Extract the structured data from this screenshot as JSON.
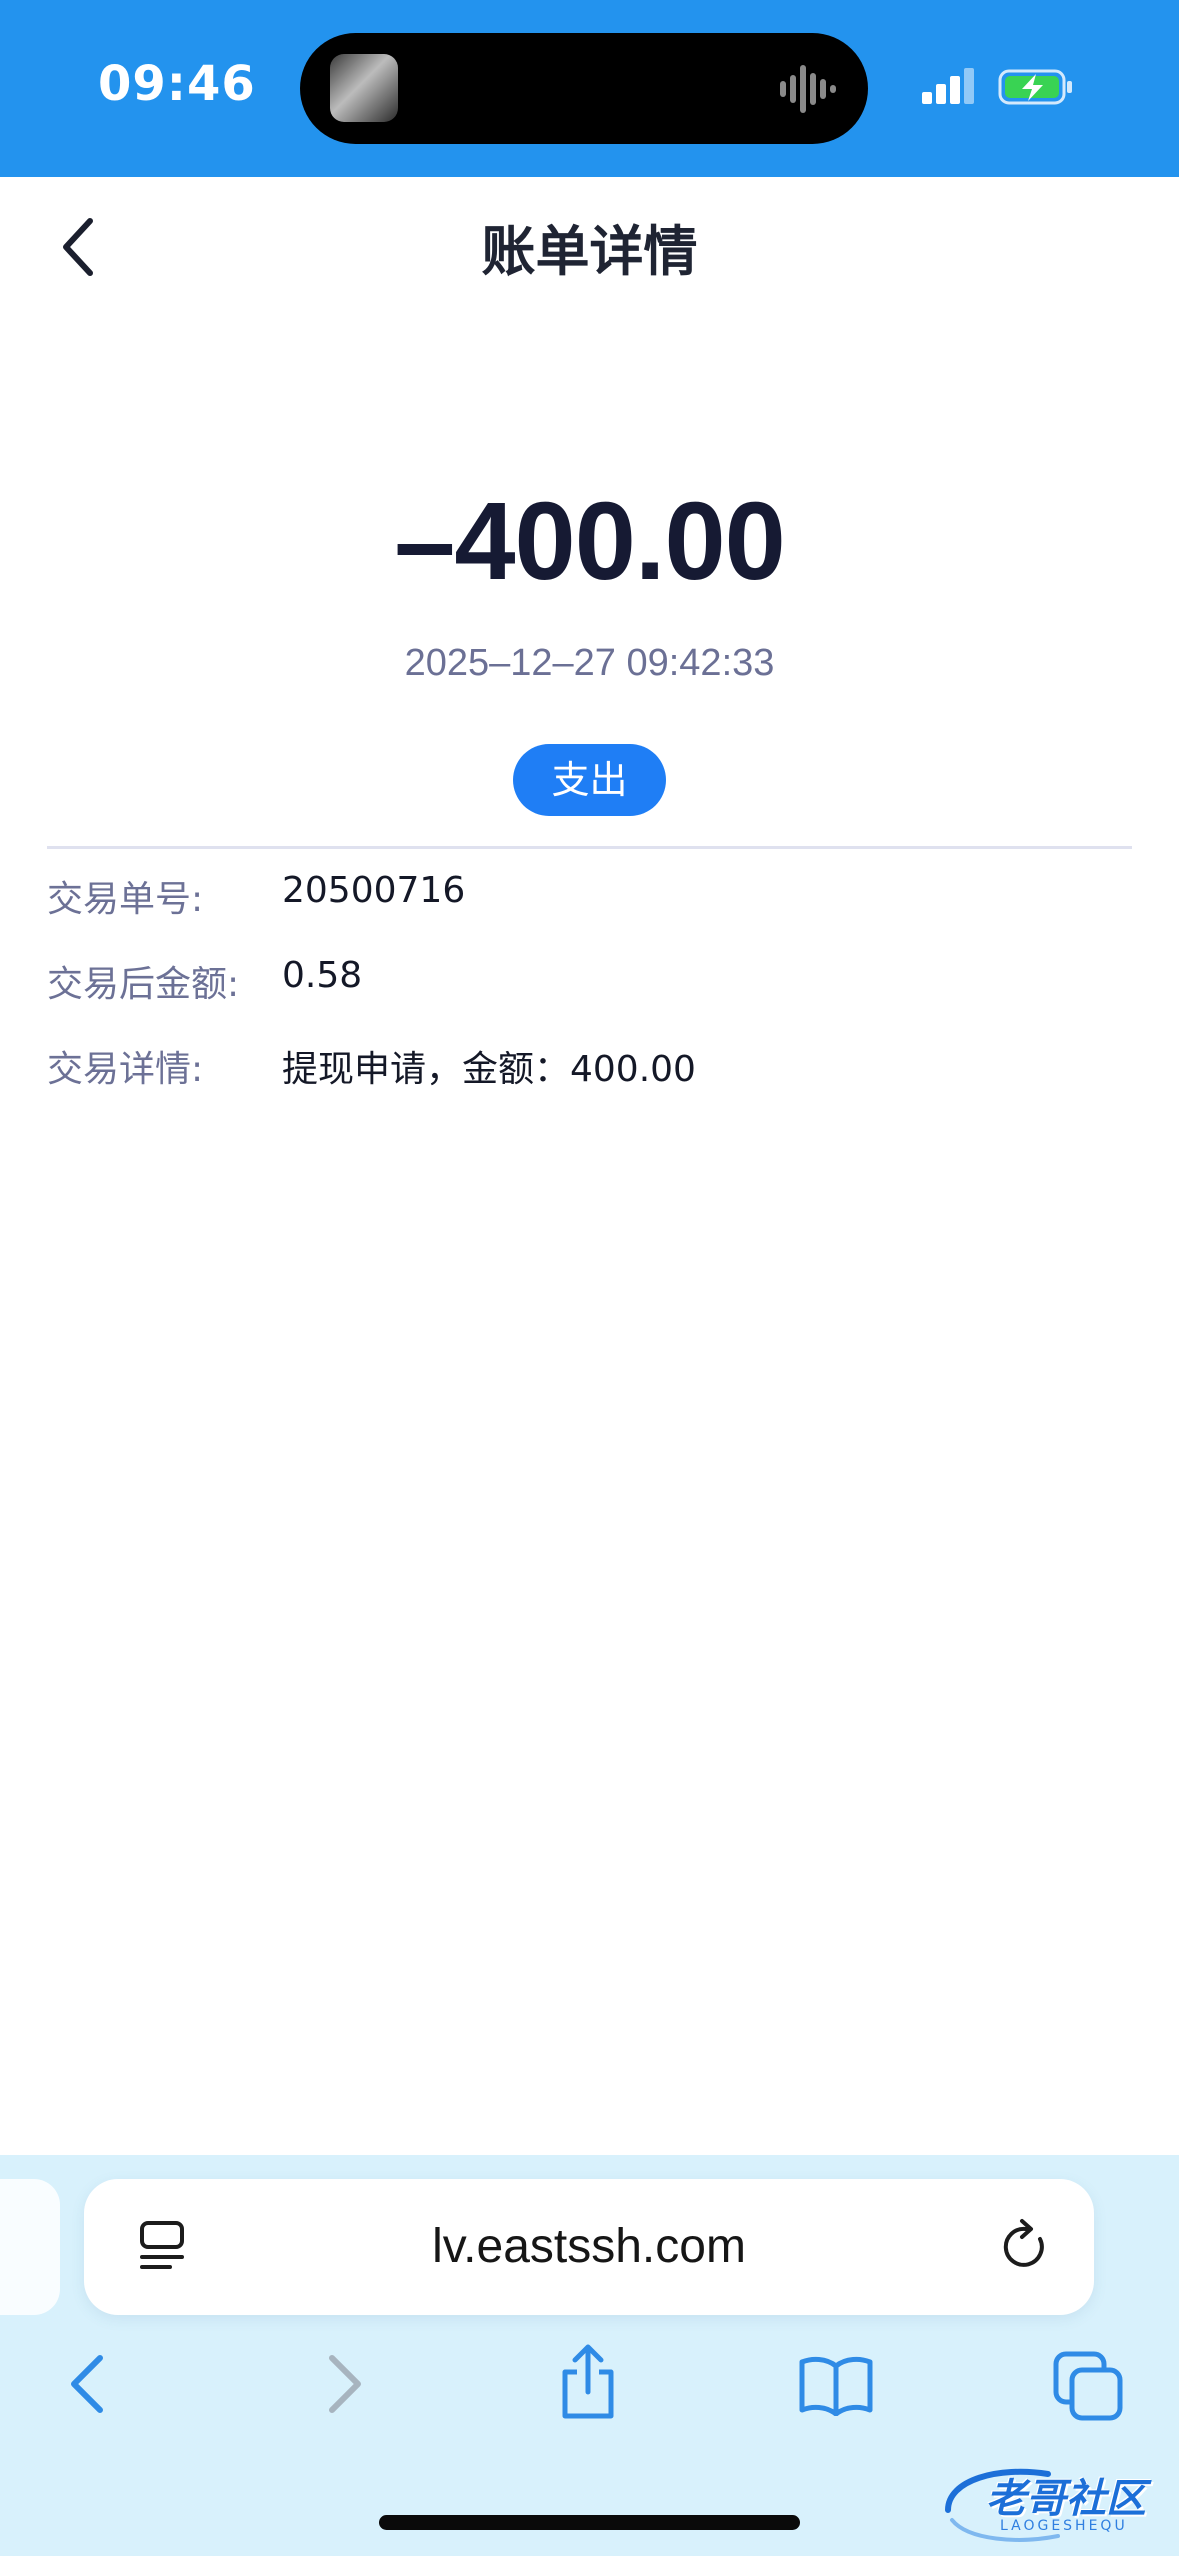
{
  "status_bar": {
    "time": "09:46",
    "background": "#2393ee"
  },
  "header": {
    "title": "账单详情",
    "back_icon": "chevron-left-icon"
  },
  "transaction": {
    "amount": "–400.00",
    "datetime": "2025–12–27 09:42:33",
    "type_badge": "支出",
    "badge_color": "#1f7ef5"
  },
  "details": [
    {
      "label": "交易单号:",
      "value": "20500716"
    },
    {
      "label": "交易后金额:",
      "value": "0.58"
    },
    {
      "label": "交易详情:",
      "value": "提现申请，金额：400.00"
    }
  ],
  "browser": {
    "url": "lv.eastssh.com",
    "bar_background": "#d8f1fc",
    "icons": [
      "reader-icon",
      "reload-icon",
      "back-icon",
      "forward-icon",
      "share-icon",
      "bookmarks-icon",
      "tabs-icon"
    ]
  },
  "watermark": {
    "text": "老哥社区",
    "sub": "LAOGESHEQU"
  }
}
